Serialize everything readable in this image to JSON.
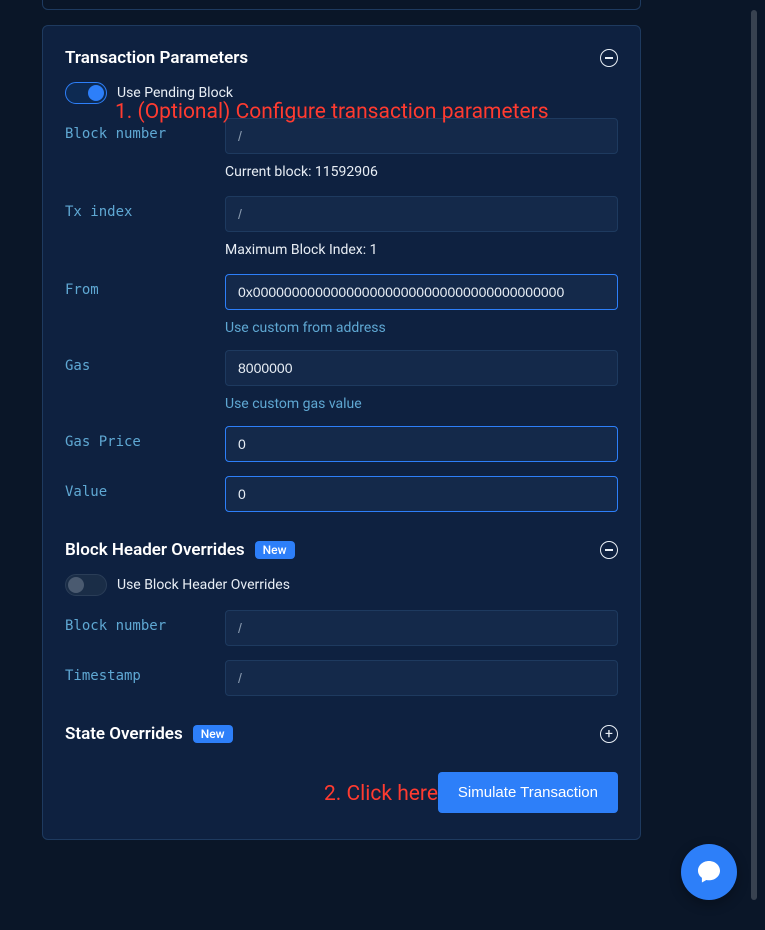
{
  "annotations": {
    "step1": "1. (Optional) Configure transaction parameters",
    "step2": "2. Click here"
  },
  "transaction_params": {
    "title": "Transaction Parameters",
    "use_pending_label": "Use Pending Block",
    "fields": {
      "block_number": {
        "label": "Block number",
        "value": "/"
      },
      "current_block": "Current block: 11592906",
      "tx_index": {
        "label": "Tx index",
        "value": "/"
      },
      "max_block_index": "Maximum Block Index: 1",
      "from": {
        "label": "From",
        "value": "0x0000000000000000000000000000000000000000",
        "link": "Use custom from address"
      },
      "gas": {
        "label": "Gas",
        "value": "8000000",
        "link": "Use custom gas value"
      },
      "gas_price": {
        "label": "Gas Price",
        "value": "0"
      },
      "value": {
        "label": "Value",
        "value": "0"
      }
    }
  },
  "block_header": {
    "title": "Block Header Overrides",
    "badge": "New",
    "toggle_label": "Use Block Header Overrides",
    "fields": {
      "block_number": {
        "label": "Block number",
        "value": "/"
      },
      "timestamp": {
        "label": "Timestamp",
        "value": "/"
      }
    }
  },
  "state_overrides": {
    "title": "State Overrides",
    "badge": "New"
  },
  "actions": {
    "simulate": "Simulate Transaction"
  }
}
